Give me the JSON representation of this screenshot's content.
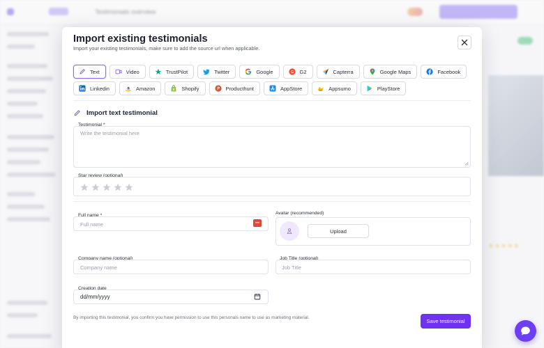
{
  "background": {
    "breadcrumb": "Testimonials overview"
  },
  "modal": {
    "title": "Import existing testimonials",
    "subtitle": "Import your existing testimonials, make sure to add the source url when applicable.",
    "sources_row1": [
      {
        "label": "Text",
        "icon": "pencil-icon",
        "active": true
      },
      {
        "label": "Video",
        "icon": "video-icon"
      },
      {
        "label": "TrustPilot",
        "icon": "trustpilot-star-icon"
      },
      {
        "label": "Twitter",
        "icon": "twitter-bird-icon"
      },
      {
        "label": "Google",
        "icon": "google-g-icon"
      },
      {
        "label": "G2",
        "icon": "g2-icon"
      },
      {
        "label": "Capterra",
        "icon": "capterra-icon"
      },
      {
        "label": "Google Maps",
        "icon": "map-pin-icon"
      },
      {
        "label": "Facebook",
        "icon": "facebook-icon"
      }
    ],
    "sources_row2": [
      {
        "label": "Linkedin",
        "icon": "linkedin-icon"
      },
      {
        "label": "Amazon",
        "icon": "amazon-icon"
      },
      {
        "label": "Shopify",
        "icon": "shopify-bag-icon"
      },
      {
        "label": "Producthunt",
        "icon": "producthunt-icon"
      },
      {
        "label": "AppStore",
        "icon": "appstore-icon"
      },
      {
        "label": "Appsumo",
        "icon": "appsumo-icon"
      },
      {
        "label": "PlayStore",
        "icon": "playstore-icon"
      }
    ],
    "section_title": "Import text testimonial",
    "fields": {
      "testimonial_label": "Testimonial *",
      "testimonial_placeholder": "Write the testimonial here",
      "star_label": "Star review (optional)",
      "full_name_label": "Full name *",
      "full_name_placeholder": "Full name",
      "avatar_label": "Avatar (recommended)",
      "upload_label": "Upload",
      "company_label": "Company name (optional)",
      "company_placeholder": "Company name",
      "job_label": "Job Title (optional)",
      "job_placeholder": "Job Title",
      "date_label": "Creation date",
      "date_value": "dd/mm/yyyy"
    },
    "consent_text": "By importing this testimonial, you confirm you have permission to use this personals name to use as marketing material.",
    "save_label": "Save testimonial"
  },
  "colors": {
    "accent": "#6f31f2",
    "active_border": "#8b6cf2"
  }
}
